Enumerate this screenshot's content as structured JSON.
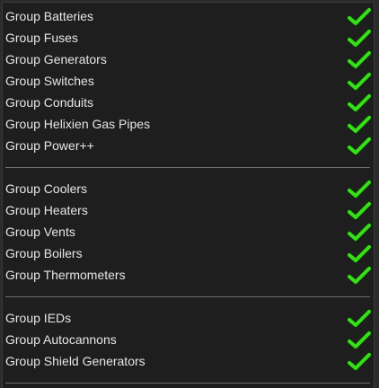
{
  "accent": "#3bdc1e",
  "groups": [
    {
      "items": [
        {
          "label": "Group Batteries",
          "checked": true,
          "icon": "checkmark-icon"
        },
        {
          "label": "Group Fuses",
          "checked": true,
          "icon": "checkmark-icon"
        },
        {
          "label": "Group Generators",
          "checked": true,
          "icon": "checkmark-icon"
        },
        {
          "label": "Group Switches",
          "checked": true,
          "icon": "checkmark-icon"
        },
        {
          "label": "Group Conduits",
          "checked": true,
          "icon": "checkmark-icon"
        },
        {
          "label": "Group Helixien Gas Pipes",
          "checked": true,
          "icon": "checkmark-icon"
        },
        {
          "label": "Group Power++",
          "checked": true,
          "icon": "checkmark-icon"
        }
      ]
    },
    {
      "items": [
        {
          "label": "Group Coolers",
          "checked": true,
          "icon": "checkmark-icon"
        },
        {
          "label": "Group Heaters",
          "checked": true,
          "icon": "checkmark-icon"
        },
        {
          "label": "Group Vents",
          "checked": true,
          "icon": "checkmark-icon"
        },
        {
          "label": "Group Boilers",
          "checked": true,
          "icon": "checkmark-icon"
        },
        {
          "label": "Group Thermometers",
          "checked": true,
          "icon": "checkmark-icon"
        }
      ]
    },
    {
      "items": [
        {
          "label": "Group IEDs",
          "checked": true,
          "icon": "checkmark-icon"
        },
        {
          "label": "Group Autocannons",
          "checked": true,
          "icon": "checkmark-icon"
        },
        {
          "label": "Group Shield Generators",
          "checked": true,
          "icon": "checkmark-icon"
        }
      ]
    }
  ]
}
